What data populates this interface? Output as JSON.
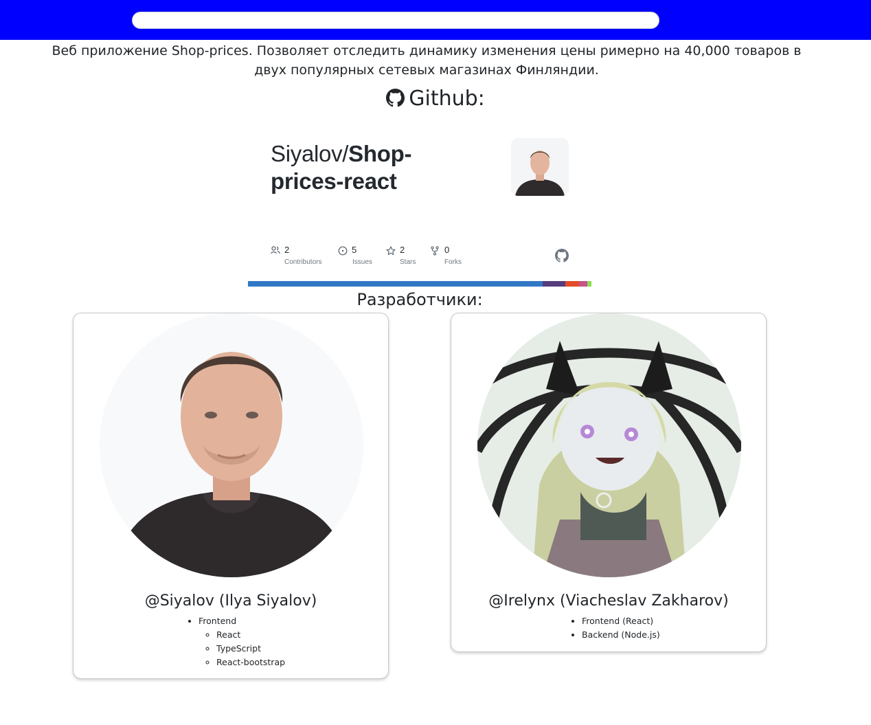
{
  "header": {
    "search_placeholder": "",
    "bg_color": "#0000ff"
  },
  "description": "Веб приложение Shop-prices. Позволяет отследить динамику изменения цены римерно на 40,000 товаров в двух популярных сетевых магазинах Финляндии.",
  "github": {
    "title": "Github:",
    "icon": "github-icon",
    "repo": {
      "owner": "Siyalov/",
      "name_line1": "Shop-",
      "name_line2": "prices-react",
      "stats": [
        {
          "icon": "contributors-icon",
          "value": "2",
          "label": "Contributors"
        },
        {
          "icon": "issues-icon",
          "value": "5",
          "label": "Issues"
        },
        {
          "icon": "stars-icon",
          "value": "2",
          "label": "Stars"
        },
        {
          "icon": "forks-icon",
          "value": "0",
          "label": "Forks"
        }
      ],
      "languages": [
        {
          "share": 0.858,
          "color": "#3178c6"
        },
        {
          "share": 0.066,
          "color": "#563d7c"
        },
        {
          "share": 0.04,
          "color": "#e34c26"
        },
        {
          "share": 0.024,
          "color": "#c6538c"
        },
        {
          "share": 0.012,
          "color": "#89e051"
        }
      ]
    }
  },
  "developers": {
    "title": "Разработчики:",
    "list": [
      {
        "name": "@Siyalov (Ilya Siyalov)",
        "skills": [
          {
            "label": "Frontend",
            "sub": [
              "React",
              "TypeScript",
              "React-bootstrap"
            ]
          }
        ]
      },
      {
        "name": "@Irelynx (Viacheslav Zakharov)",
        "skills": [
          {
            "label": " Frontend (React)"
          },
          {
            "label": "Backend (Node.js)"
          }
        ]
      }
    ]
  }
}
